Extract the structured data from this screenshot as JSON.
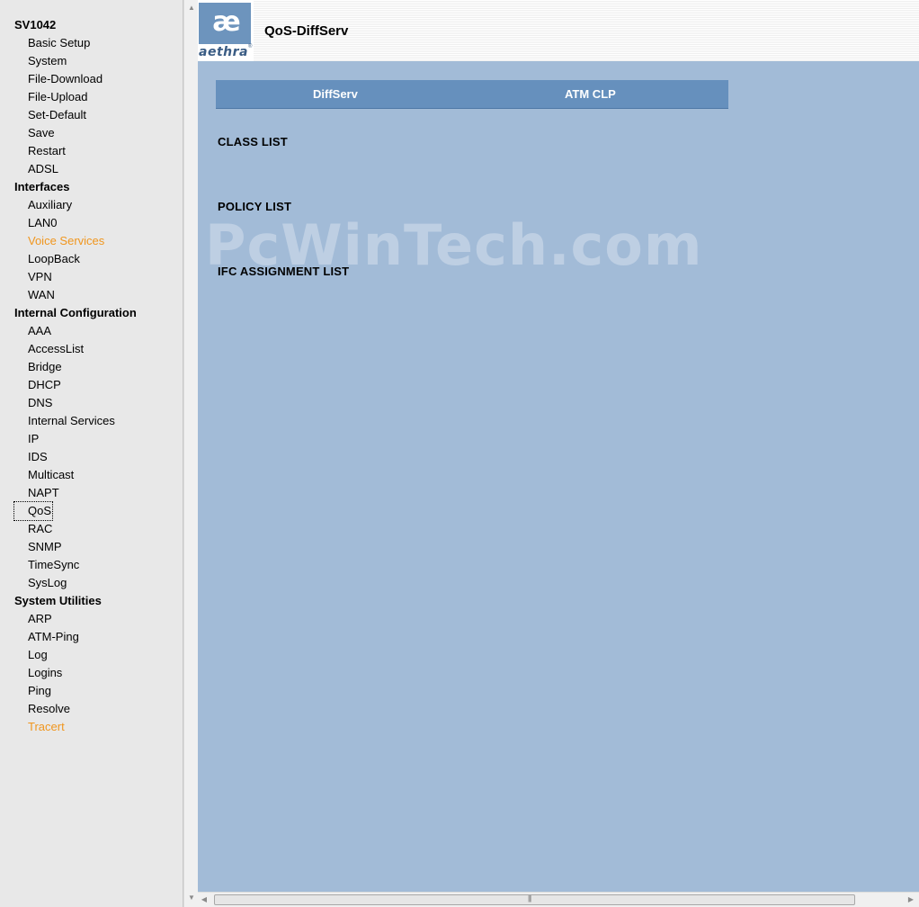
{
  "nav": {
    "sections": [
      {
        "title": "SV1042",
        "items": [
          {
            "label": "Basic Setup"
          },
          {
            "label": "System"
          },
          {
            "label": "File-Download"
          },
          {
            "label": "File-Upload"
          },
          {
            "label": "Set-Default"
          },
          {
            "label": "Save"
          },
          {
            "label": "Restart"
          },
          {
            "label": "ADSL"
          }
        ]
      },
      {
        "title": "Interfaces",
        "items": [
          {
            "label": "Auxiliary"
          },
          {
            "label": "LAN0"
          },
          {
            "label": "Voice Services",
            "highlighted": true
          },
          {
            "label": "LoopBack"
          },
          {
            "label": "VPN"
          },
          {
            "label": "WAN"
          }
        ]
      },
      {
        "title": "Internal Configuration",
        "items": [
          {
            "label": "AAA"
          },
          {
            "label": "AccessList"
          },
          {
            "label": "Bridge"
          },
          {
            "label": "DHCP"
          },
          {
            "label": "DNS"
          },
          {
            "label": "Internal Services"
          },
          {
            "label": "IP"
          },
          {
            "label": "IDS"
          },
          {
            "label": "Multicast"
          },
          {
            "label": "NAPT"
          },
          {
            "label": "QoS",
            "focused": true
          },
          {
            "label": "RAC"
          },
          {
            "label": "SNMP"
          },
          {
            "label": "TimeSync"
          },
          {
            "label": "SysLog"
          }
        ]
      },
      {
        "title": "System Utilities",
        "items": [
          {
            "label": "ARP"
          },
          {
            "label": "ATM-Ping"
          },
          {
            "label": "Log"
          },
          {
            "label": "Logins"
          },
          {
            "label": "Ping"
          },
          {
            "label": "Resolve"
          },
          {
            "label": "Tracert",
            "highlighted": true
          }
        ]
      }
    ]
  },
  "header": {
    "logo_glyph": "æ",
    "logo_text": "aethra",
    "logo_reg": "®",
    "title": "QoS-DiffServ"
  },
  "tabs": [
    {
      "label": "DiffServ"
    },
    {
      "label": "ATM CLP"
    }
  ],
  "lists": {
    "class_list": "CLASS LIST",
    "policy_list": "POLICY LIST",
    "ifc_assignment_list": "IFC ASSIGNMENT LIST"
  },
  "watermark": "PcWinTech.com",
  "scrollbar": {
    "up_arrow": "▲",
    "down_arrow": "▼",
    "left_arrow": "◀",
    "right_arrow": "▶",
    "grip": "|||"
  },
  "colors": {
    "content_bg": "#a2bbd7",
    "tab_bar": "#6690bd",
    "highlight_link": "#f0961e",
    "logo_blue": "#6d94bd"
  }
}
